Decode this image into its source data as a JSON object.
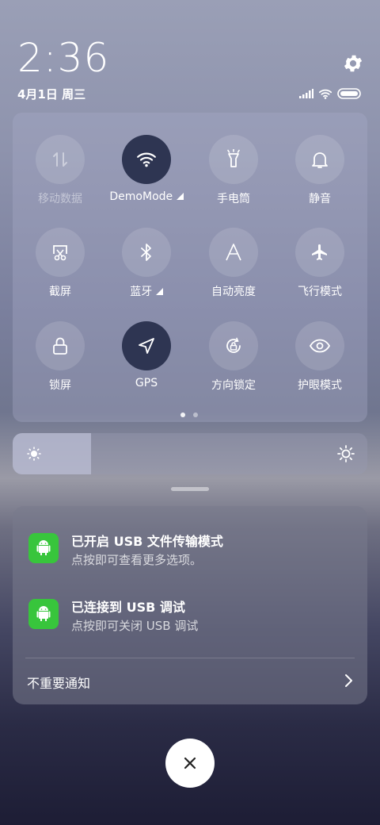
{
  "status_bar": {
    "time": "2:36",
    "date": "4月1日 周三",
    "icons": [
      "signal-icon",
      "wifi-icon",
      "battery-icon"
    ]
  },
  "settings_icon": "gear-icon",
  "quick_settings": {
    "tiles": [
      {
        "label": "移动数据",
        "icon": "mobile-data-icon",
        "state": "disabled"
      },
      {
        "label": "DemoMode",
        "icon": "wifi-icon",
        "state": "on",
        "expandable": true
      },
      {
        "label": "手电筒",
        "icon": "flashlight-icon",
        "state": "off"
      },
      {
        "label": "静音",
        "icon": "bell-icon",
        "state": "off"
      },
      {
        "label": "截屏",
        "icon": "screenshot-icon",
        "state": "off"
      },
      {
        "label": "蓝牙",
        "icon": "bluetooth-icon",
        "state": "off",
        "expandable": true
      },
      {
        "label": "自动亮度",
        "icon": "auto-brightness-icon",
        "state": "off"
      },
      {
        "label": "飞行模式",
        "icon": "airplane-icon",
        "state": "off"
      },
      {
        "label": "锁屏",
        "icon": "lock-icon",
        "state": "off"
      },
      {
        "label": "GPS",
        "icon": "location-icon",
        "state": "on"
      },
      {
        "label": "方向锁定",
        "icon": "rotation-lock-icon",
        "state": "off"
      },
      {
        "label": "护眼模式",
        "icon": "eye-icon",
        "state": "off"
      }
    ],
    "page_indicator": {
      "pages": 2,
      "current": 1
    }
  },
  "brightness": {
    "level": 0.22,
    "icons": [
      "brightness-low-icon",
      "brightness-high-icon"
    ]
  },
  "notifications": {
    "items": [
      {
        "title": "已开启 USB 文件传输模式",
        "text": "点按即可查看更多选项。",
        "icon": "android-icon"
      },
      {
        "title": "已连接到 USB 调试",
        "text": "点按即可关闭 USB 调试",
        "icon": "android-icon"
      }
    ],
    "unimportant_label": "不重要通知"
  },
  "close_icon": "close-icon",
  "colors": {
    "active_tile": "#2e3552",
    "app_icon": "#38c53c"
  }
}
